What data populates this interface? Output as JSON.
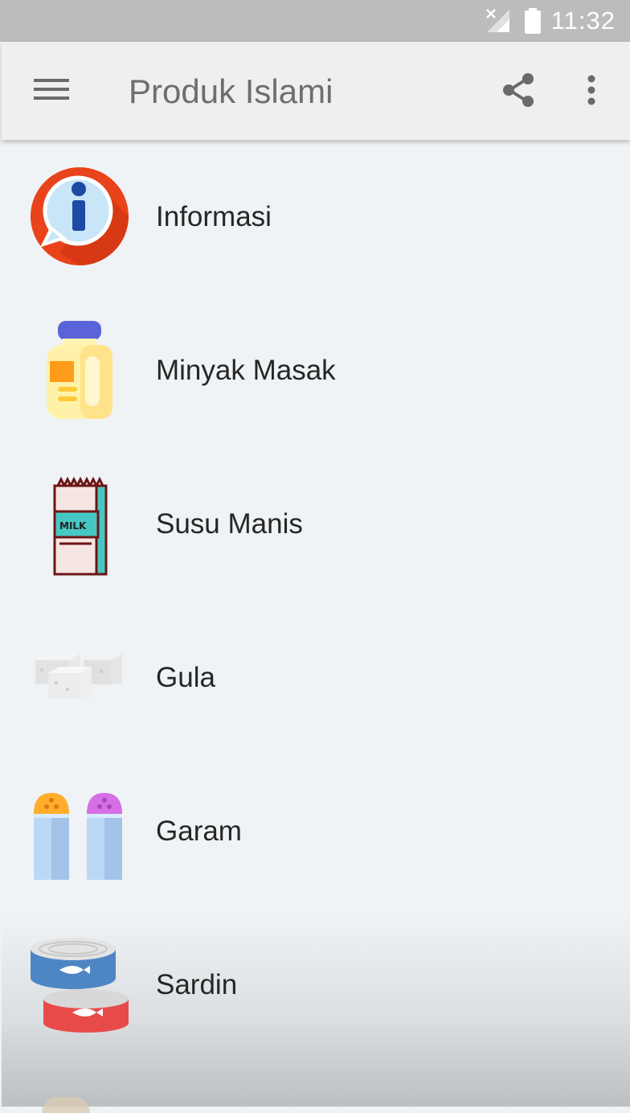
{
  "status_bar": {
    "time": "11:32"
  },
  "app_bar": {
    "title": "Produk Islami"
  },
  "items": [
    {
      "label": "Informasi",
      "icon": "info-icon"
    },
    {
      "label": "Minyak Masak",
      "icon": "oil-bottle-icon"
    },
    {
      "label": "Susu Manis",
      "icon": "milk-carton-icon"
    },
    {
      "label": "Gula",
      "icon": "sugar-cubes-icon"
    },
    {
      "label": "Garam",
      "icon": "salt-shakers-icon"
    },
    {
      "label": "Sardin",
      "icon": "sardine-cans-icon"
    }
  ]
}
